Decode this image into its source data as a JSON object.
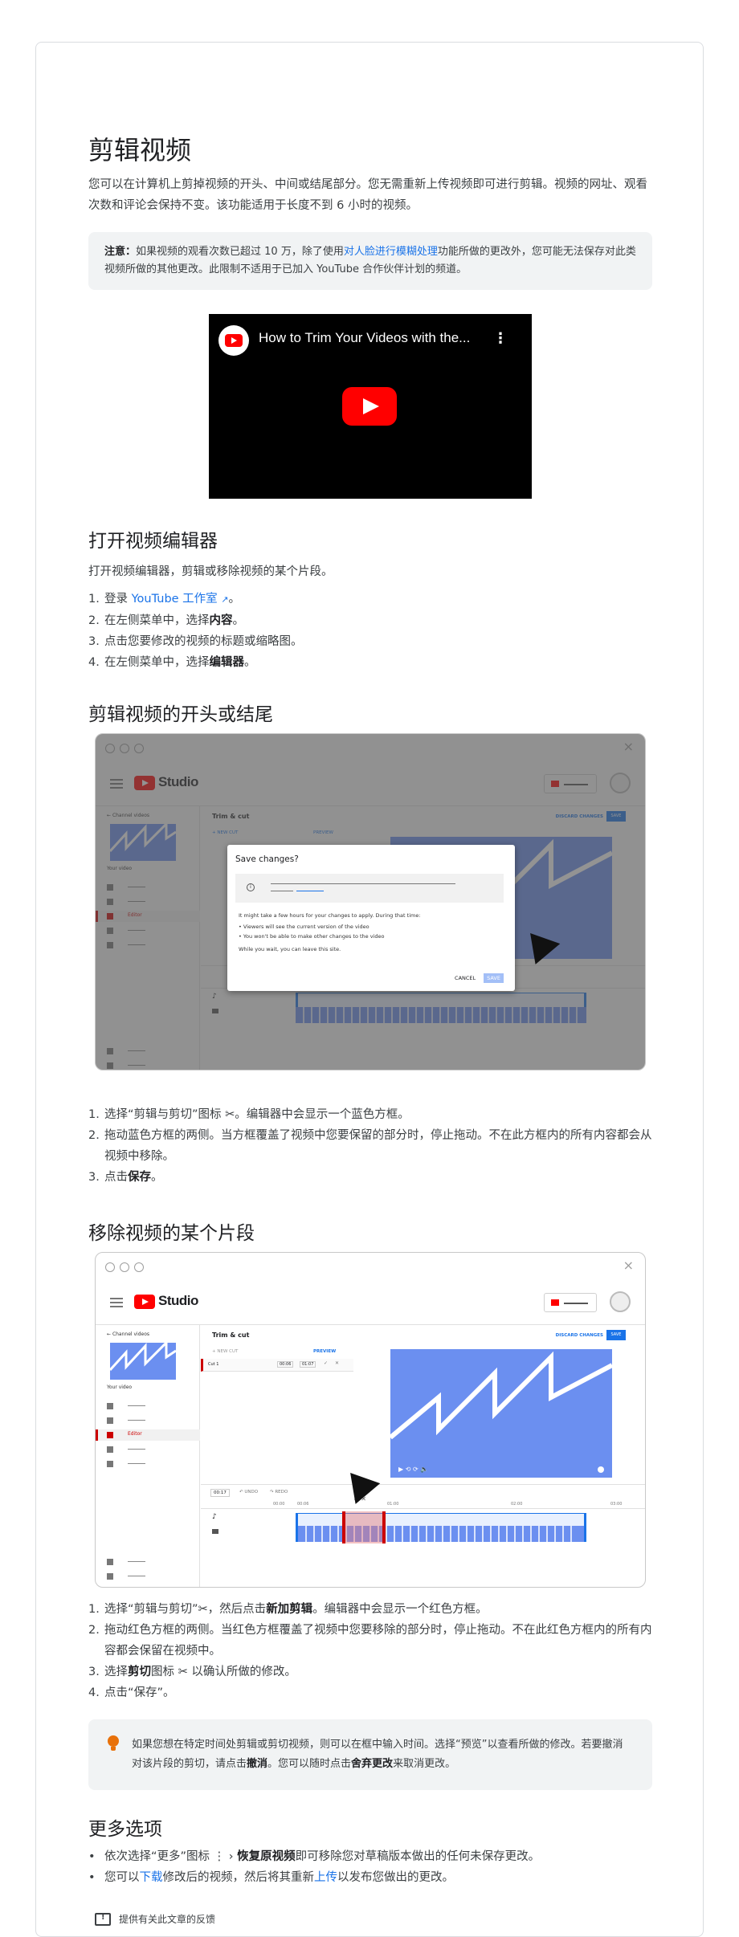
{
  "title": "剪辑视频",
  "intro": "您可以在计算机上剪掉视频的开头、中间或结尾部分。您无需重新上传视频即可进行剪辑。视频的网址、观看次数和评论会保持不变。该功能适用于长度不到 6 小时的视频。",
  "note": {
    "label": "注意：",
    "text1": "如果视频的观看次数已超过 10 万，除了使用",
    "link": "对人脸进行模糊处理",
    "text2": "功能所做的更改外，您可能无法保存对此类视频所做的其他更改。此限制不适用于已加入 YouTube 合作伙伴计划的频道。"
  },
  "video": {
    "title": "How to Trim Your Videos with the..."
  },
  "section1": {
    "heading": "打开视频编辑器",
    "desc": "打开视频编辑器，剪辑或移除视频的某个片段。",
    "steps": [
      {
        "num": "1.",
        "pre": "登录 ",
        "link": "YouTube 工作室",
        "post": "。"
      },
      {
        "num": "2.",
        "pre": "在左侧菜单中，选择",
        "bold": "内容",
        "post": "。"
      },
      {
        "num": "3.",
        "pre": "点击您要修改的视频的标题或缩略图。"
      },
      {
        "num": "4.",
        "pre": "在左侧菜单中，选择",
        "bold": "编辑器",
        "post": "。"
      }
    ]
  },
  "section2": {
    "heading": "剪辑视频的开头或结尾",
    "steps": [
      {
        "num": "1.",
        "text": "选择“剪辑与剪切”图标 ✂。编辑器中会显示一个蓝色方框。"
      },
      {
        "num": "2.",
        "text": "拖动蓝色方框的两侧。当方框覆盖了视频中您要保留的部分时，停止拖动。不在此方框内的所有内容都会从视频中移除。"
      },
      {
        "num": "3.",
        "pre": "点击",
        "bold": "保存",
        "post": "。"
      }
    ]
  },
  "section3": {
    "heading": "移除视频的某个片段",
    "steps": [
      {
        "num": "1.",
        "pre": "选择“剪辑与剪切”✂，然后点击",
        "bold": "新加剪辑",
        "post": "。编辑器中会显示一个红色方框。"
      },
      {
        "num": "2.",
        "pre": "拖动红色方框的两侧。当红色方框覆盖了视频中您要移除的部分时，停止拖动。不在此红色方框内的所有内容都会保留在视频中。"
      },
      {
        "num": "3.",
        "pre": "选择",
        "bold": "剪切",
        "post": "图标 ✂ 以确认所做的修改。"
      },
      {
        "num": "4.",
        "pre": "点击“保存”。"
      }
    ]
  },
  "tip": {
    "t1": "如果您想在特定时间处剪辑或剪切视频，则可以在框中输入时间。选择“预览”以查看所做的修改。若要撤消对该片段的剪切，请点击",
    "b1": "撤消",
    "t2": "。您可以随时点击",
    "b2": "舍弃更改",
    "t3": "来取消更改。"
  },
  "section4": {
    "heading": "更多选项",
    "b1_pre": "依次选择“更多”图标 ⋮ › ",
    "b1_bold": "恢复原视频",
    "b1_post": "即可移除您对草稿版本做出的任何未保存更改。",
    "b2_pre": "您可以",
    "b2_link1": "下载",
    "b2_mid": "修改后的视频，然后将其重新",
    "b2_link2": "上传",
    "b2_post": "以发布您做出的更改。"
  },
  "feedback": "提供有关此文章的反馈",
  "studio": {
    "brand": "Studio",
    "channel": "Channel videos",
    "your_video": "Your video",
    "editor": "Editor",
    "trim": "Trim & cut",
    "discard": "DISCARD CHANGES",
    "save": "SAVE",
    "new_cut": "+ NEW CUT",
    "preview": "PREVIEW",
    "cut1": "Cut 1",
    "cut_start": "00:06",
    "cut_end": "01:07",
    "time": "00:17",
    "undo": "UNDO",
    "redo": "REDO",
    "t0": "00:00",
    "t1": "00:06",
    "t2": "01:00",
    "t3": "02:00",
    "t4": "03:00",
    "dialog_title": "Save changes?",
    "dialog_l1": "It might take a few hours for your changes to apply. During that time:",
    "dialog_b1": "Viewers will see the current version of the video",
    "dialog_b2": "You won't be able to make other changes to the video",
    "dialog_l2": "While you wait, you can leave this site.",
    "cancel": "CANCEL"
  }
}
